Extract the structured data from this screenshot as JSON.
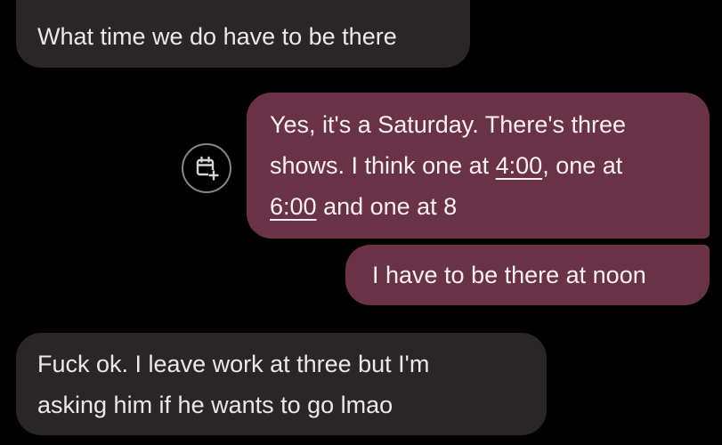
{
  "messages": [
    {
      "direction": "incoming",
      "lines": [
        "What time we do have to be there"
      ]
    },
    {
      "direction": "outgoing",
      "line1": "Yes, it's a Saturday. There's three",
      "line2_pre": "shows. I think one at ",
      "line2_link": "4:00",
      "line2_post": ", one at",
      "line3_link": "6:00",
      "line3_post": " and one at 8"
    },
    {
      "direction": "outgoing",
      "lines": [
        "I have to be there at noon"
      ]
    },
    {
      "direction": "incoming",
      "lines": [
        "Fuck ok. I leave work at three but I'm",
        "asking him if he wants to go lmao"
      ]
    }
  ],
  "actions": {
    "calendar_icon": "calendar-add-icon"
  },
  "colors": {
    "background": "#000000",
    "incoming_bubble": "#2a2628",
    "outgoing_bubble": "#6a3247",
    "icon_stroke": "#d8d3d5"
  }
}
